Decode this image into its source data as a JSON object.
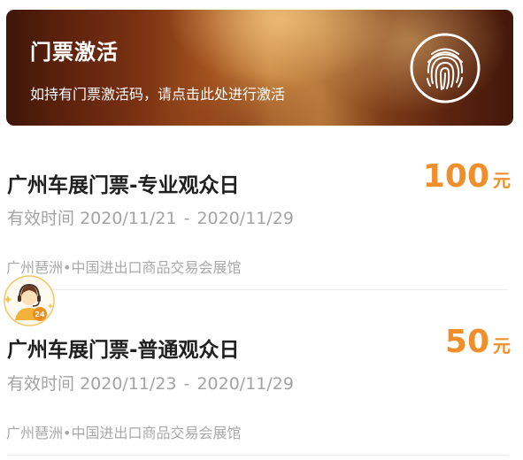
{
  "banner": {
    "title": "门票激活",
    "subtitle": "如持有门票激活码，请点击此处进行激活",
    "icon": "fingerprint-icon"
  },
  "tickets": [
    {
      "name": "广州车展门票-专业观众日",
      "price": "100",
      "unit": "元",
      "validity_label": "有效时间",
      "start": "2020/11/21",
      "end": "2020/11/29",
      "venue": "广州琶洲•中国进出口商品交易会展馆"
    },
    {
      "name": "广州车展门票-普通观众日",
      "price": "50",
      "unit": "元",
      "validity_label": "有效时间",
      "start": "2020/11/23",
      "end": "2020/11/29",
      "venue": "广州琶洲•中国进出口商品交易会展馆"
    }
  ],
  "service_widget": {
    "icon": "customer-service-icon",
    "badge": "24"
  },
  "colors": {
    "price": "#ef8f2b",
    "title": "#1f1f1f",
    "muted": "#a3a3a3"
  }
}
